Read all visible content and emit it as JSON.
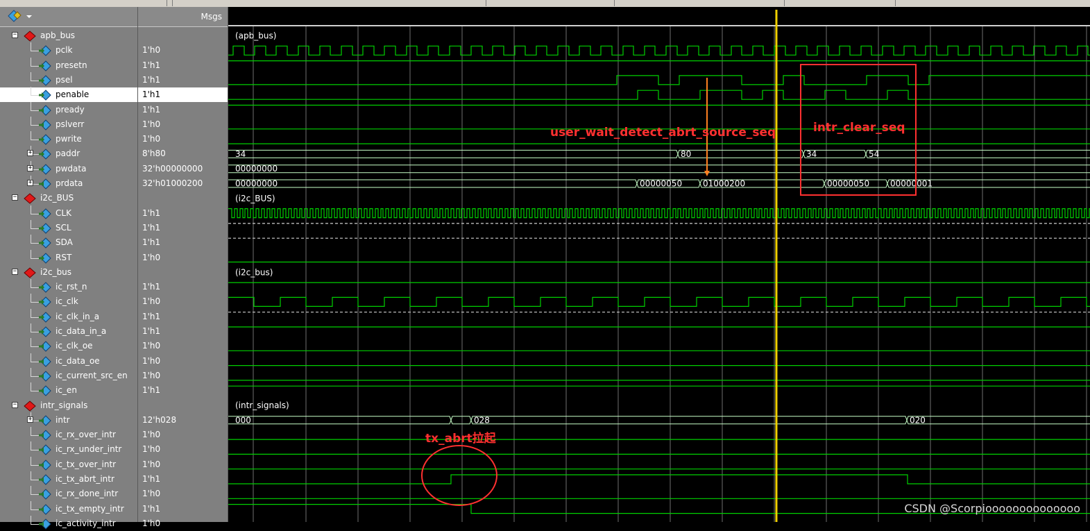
{
  "header": {
    "msgs_label": "Msgs"
  },
  "signals": [
    {
      "name": "apb_bus",
      "value": "",
      "level": 0,
      "kind": "group",
      "expander": "minus"
    },
    {
      "name": "pclk",
      "value": "1'h0",
      "level": 1,
      "kind": "in"
    },
    {
      "name": "presetn",
      "value": "1'h1",
      "level": 1,
      "kind": "in"
    },
    {
      "name": "psel",
      "value": "1'h1",
      "level": 1,
      "kind": "in"
    },
    {
      "name": "penable",
      "value": "1'h1",
      "level": 1,
      "kind": "in",
      "selected": true
    },
    {
      "name": "pready",
      "value": "1'h1",
      "level": 1,
      "kind": "out"
    },
    {
      "name": "pslverr",
      "value": "1'h0",
      "level": 1,
      "kind": "out"
    },
    {
      "name": "pwrite",
      "value": "1'h0",
      "level": 1,
      "kind": "in"
    },
    {
      "name": "paddr",
      "value": "8'h80",
      "level": 1,
      "kind": "in",
      "expander": "plus"
    },
    {
      "name": "pwdata",
      "value": "32'h00000000",
      "level": 1,
      "kind": "in",
      "expander": "plus"
    },
    {
      "name": "prdata",
      "value": "32'h01000200",
      "level": 1,
      "kind": "out",
      "expander": "plus"
    },
    {
      "name": "i2c_BUS",
      "value": "",
      "level": 0,
      "kind": "group",
      "expander": "minus"
    },
    {
      "name": "CLK",
      "value": "1'h1",
      "level": 1,
      "kind": "inout"
    },
    {
      "name": "SCL",
      "value": "1'h1",
      "level": 1,
      "kind": "inout"
    },
    {
      "name": "SDA",
      "value": "1'h1",
      "level": 1,
      "kind": "inout"
    },
    {
      "name": "RST",
      "value": "1'h0",
      "level": 1,
      "kind": "inout"
    },
    {
      "name": "i2c_bus",
      "value": "",
      "level": 0,
      "kind": "group",
      "expander": "minus"
    },
    {
      "name": "ic_rst_n",
      "value": "1'h1",
      "level": 1,
      "kind": "in"
    },
    {
      "name": "ic_clk",
      "value": "1'h0",
      "level": 1,
      "kind": "in"
    },
    {
      "name": "ic_clk_in_a",
      "value": "1'h1",
      "level": 1,
      "kind": "in"
    },
    {
      "name": "ic_data_in_a",
      "value": "1'h1",
      "level": 1,
      "kind": "in"
    },
    {
      "name": "ic_clk_oe",
      "value": "1'h0",
      "level": 1,
      "kind": "out"
    },
    {
      "name": "ic_data_oe",
      "value": "1'h0",
      "level": 1,
      "kind": "out"
    },
    {
      "name": "ic_current_src_en",
      "value": "1'h0",
      "level": 1,
      "kind": "out"
    },
    {
      "name": "ic_en",
      "value": "1'h1",
      "level": 1,
      "kind": "out"
    },
    {
      "name": "intr_signals",
      "value": "",
      "level": 0,
      "kind": "group",
      "expander": "minus"
    },
    {
      "name": "intr",
      "value": "12'h028",
      "level": 1,
      "kind": "out",
      "expander": "plus"
    },
    {
      "name": "ic_rx_over_intr",
      "value": "1'h0",
      "level": 1,
      "kind": "out"
    },
    {
      "name": "ic_rx_under_intr",
      "value": "1'h0",
      "level": 1,
      "kind": "out"
    },
    {
      "name": "ic_tx_over_intr",
      "value": "1'h0",
      "level": 1,
      "kind": "out"
    },
    {
      "name": "ic_tx_abrt_intr",
      "value": "1'h1",
      "level": 1,
      "kind": "out"
    },
    {
      "name": "ic_rx_done_intr",
      "value": "1'h0",
      "level": 1,
      "kind": "out"
    },
    {
      "name": "ic_tx_empty_intr",
      "value": "1'h1",
      "level": 1,
      "kind": "out"
    },
    {
      "name": "ic_activity_intr",
      "value": "1'h0",
      "level": 1,
      "kind": "out"
    }
  ],
  "waves": {
    "group_labels": {
      "0": "(apb_bus)",
      "11": "(i2c_BUS)",
      "16": "(i2c_bus)",
      "25": "(intr_signals)"
    },
    "bus_values": {
      "paddr": [
        "34",
        "80",
        "34",
        "54"
      ],
      "pwdata": [
        "00000000"
      ],
      "prdata": [
        "00000000",
        "00000050",
        "01000200",
        "00000050",
        "00000001"
      ],
      "intr": [
        "000",
        "028",
        "020"
      ]
    },
    "annotations": {
      "user_wait": "user_wait_detect_abrt_source_seq",
      "intr_clear": "intr_clear_seq",
      "tx_abrt": "tx_abrt拉起"
    }
  },
  "watermark": "CSDN @Scorpioooooooooooooo",
  "colors": {
    "wave": "#00d000",
    "bus": "#c8ffc8",
    "cursor": "#f0d000",
    "annotation": "#ff3030",
    "arrow": "#ff8020",
    "icon_group": "#e01818",
    "icon_signal": "#3aa0e0"
  }
}
